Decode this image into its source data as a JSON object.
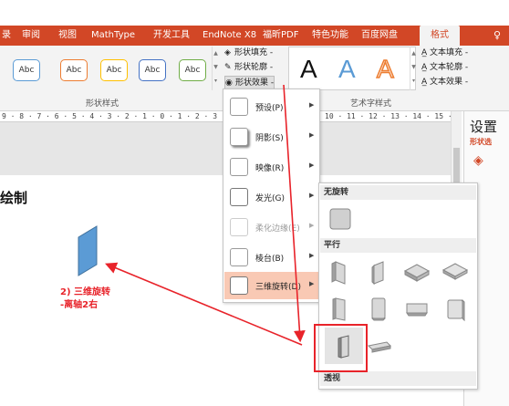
{
  "ribbon_tabs": {
    "t0": "录",
    "t1": "审阅",
    "t2": "视图",
    "t3": "MathType",
    "t4": "开发工具",
    "t5": "EndNote X8",
    "t6": "福昕PDF",
    "t7": "特色功能",
    "t8": "百度网盘",
    "t9": "格式",
    "help_icon": "lightbulb-icon"
  },
  "shape_styles": {
    "buttons": [
      "Abc",
      "Abc",
      "Abc",
      "Abc",
      "Abc"
    ],
    "colors": [
      "#5b9bd5",
      "#ed7d31",
      "#ffc000",
      "#4472c4",
      "#70ad47"
    ],
    "group_label": "形状样式",
    "fill": "形状填充 -",
    "outline": "形状轮廓 -",
    "effects": "形状效果 -"
  },
  "wordart": {
    "letters": [
      "A",
      "A",
      "A"
    ],
    "group_label": "艺术字样式",
    "text_fill": "文本填充 -",
    "text_outline": "文本轮廓 -",
    "text_effects": "文本效果 -"
  },
  "ruler": {
    "left": "9 · 8 · 7 · 6 · 5 · 4 · 3 · 2 · 1 · 0 · 1 · 2 · 3",
    "right": "10 · 11 · 12 · 13 · 14 · 15 · 16 ·"
  },
  "slide": {
    "title_fragment": "绘制",
    "annotation_line1": "2) 三维旋转",
    "annotation_line2": "-离轴2右"
  },
  "side_panel": {
    "title": "设置",
    "subtitle": "形状选"
  },
  "effects_menu": {
    "items": [
      {
        "label": "预设(P)",
        "disabled": false
      },
      {
        "label": "阴影(S)",
        "disabled": false
      },
      {
        "label": "映像(R)",
        "disabled": false
      },
      {
        "label": "发光(G)",
        "disabled": false
      },
      {
        "label": "柔化边缘(E)",
        "disabled": true
      },
      {
        "label": "棱台(B)",
        "disabled": false
      },
      {
        "label": "三维旋转(D)",
        "disabled": false
      }
    ],
    "active_item": "三维旋转(D)"
  },
  "rotation_submenu": {
    "none_header": "无旋转",
    "parallel_header": "平行",
    "perspective_header": "透视",
    "selected": "离轴2右"
  },
  "colors": {
    "accent": "#d24726",
    "annotation_red": "#e8232a",
    "shape_blue": "#5b9bd5",
    "menu_highlight": "#f9c9b4"
  }
}
